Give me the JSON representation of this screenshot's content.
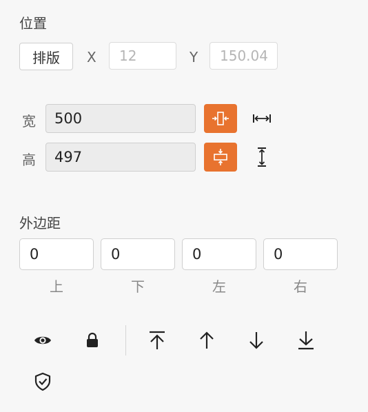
{
  "position": {
    "title": "位置",
    "layout_button": "排版",
    "x_label": "X",
    "x_value": "12",
    "y_label": "Y",
    "y_value": "150.04"
  },
  "size": {
    "width_label": "宽",
    "width_value": "500",
    "height_label": "高",
    "height_value": "497"
  },
  "margin": {
    "title": "外边距",
    "fields": [
      {
        "value": "0",
        "label": "上"
      },
      {
        "value": "0",
        "label": "下"
      },
      {
        "value": "0",
        "label": "左"
      },
      {
        "value": "0",
        "label": "右"
      }
    ]
  },
  "colors": {
    "accent": "#e8732f",
    "background": "#f7f7f7"
  },
  "icons": {
    "width_fit": "fit-width-icon",
    "width_stretch": "stretch-width-icon",
    "height_fit": "fit-height-icon",
    "height_stretch": "stretch-height-icon",
    "visibility": "eye-icon",
    "lock": "lock-icon",
    "bring_to_front": "bring-to-front-icon",
    "bring_forward": "arrow-up-icon",
    "send_backward": "arrow-down-icon",
    "send_to_back": "send-to-back-icon",
    "protect": "shield-check-icon"
  }
}
